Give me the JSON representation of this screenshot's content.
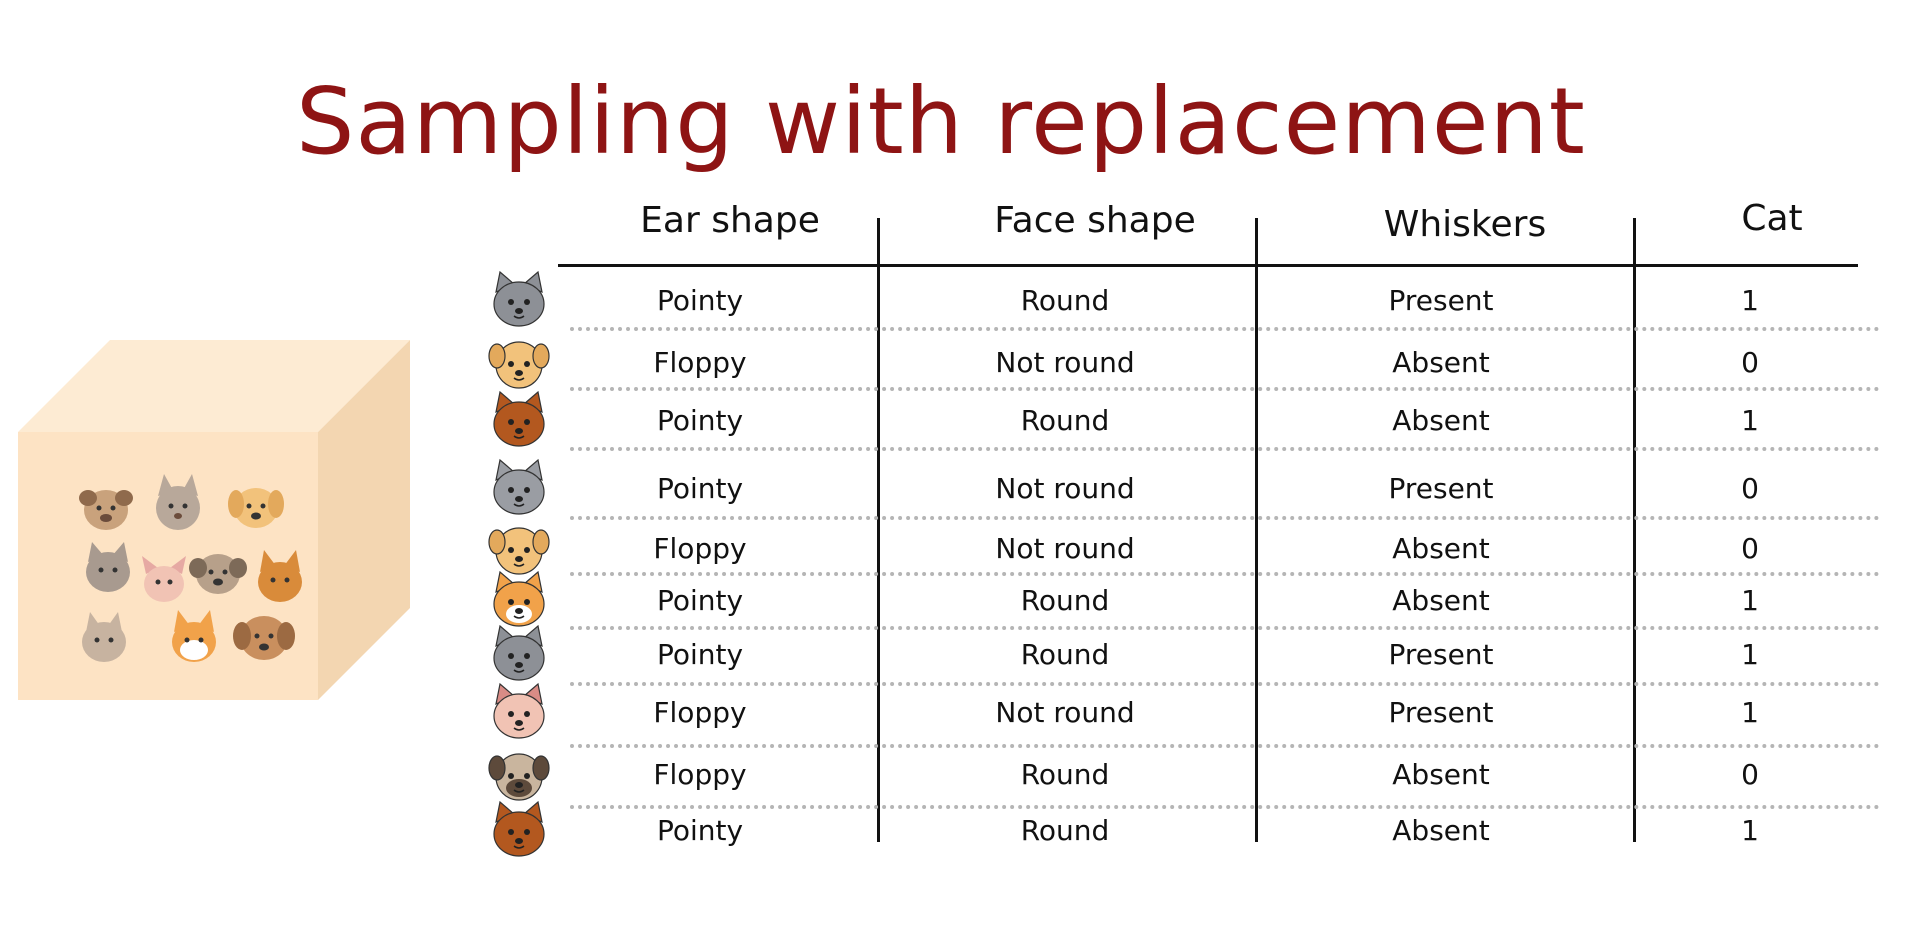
{
  "title": "Sampling with replacement",
  "table": {
    "headers": {
      "ear": "Ear shape",
      "face": "Face shape",
      "whiskers": "Whiskers",
      "cat": "Cat"
    },
    "rows": [
      {
        "animal": "gray-cat-icon",
        "ear": "Pointy",
        "face": "Round",
        "whiskers": "Present",
        "cat": "1"
      },
      {
        "animal": "yellow-dog-icon",
        "ear": "Floppy",
        "face": "Not round",
        "whiskers": "Absent",
        "cat": "0"
      },
      {
        "animal": "brown-cat-icon",
        "ear": "Pointy",
        "face": "Round",
        "whiskers": "Absent",
        "cat": "1"
      },
      {
        "animal": "gray-wolf-icon",
        "ear": "Pointy",
        "face": "Not round",
        "whiskers": "Present",
        "cat": "0"
      },
      {
        "animal": "yellow-dog-icon",
        "ear": "Floppy",
        "face": "Not round",
        "whiskers": "Absent",
        "cat": "0"
      },
      {
        "animal": "orange-white-cat-icon",
        "ear": "Pointy",
        "face": "Round",
        "whiskers": "Absent",
        "cat": "1"
      },
      {
        "animal": "gray-cat-icon",
        "ear": "Pointy",
        "face": "Round",
        "whiskers": "Present",
        "cat": "1"
      },
      {
        "animal": "pink-cat-icon",
        "ear": "Floppy",
        "face": "Not round",
        "whiskers": "Present",
        "cat": "1"
      },
      {
        "animal": "pug-dog-icon",
        "ear": "Floppy",
        "face": "Round",
        "whiskers": "Absent",
        "cat": "0"
      },
      {
        "animal": "brown-cat-icon",
        "ear": "Pointy",
        "face": "Round",
        "whiskers": "Absent",
        "cat": "1"
      }
    ]
  },
  "colors": {
    "title": "#8e1414",
    "box_front": "#fde3c4",
    "box_top": "#fdebd3",
    "box_side": "#f3d6b1"
  }
}
